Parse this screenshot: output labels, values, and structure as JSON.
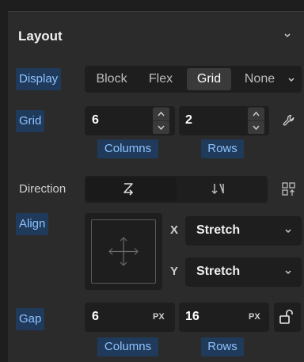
{
  "section": {
    "title": "Layout"
  },
  "display": {
    "label": "Display",
    "options": [
      "Block",
      "Flex",
      "Grid",
      "None"
    ],
    "selected": "Grid"
  },
  "grid": {
    "label": "Grid",
    "columns_value": "6",
    "rows_value": "2",
    "columns_label": "Columns",
    "rows_label": "Rows"
  },
  "direction": {
    "label": "Direction",
    "selected": "row"
  },
  "align": {
    "label": "Align",
    "x_label": "X",
    "x_value": "Stretch",
    "y_label": "Y",
    "y_value": "Stretch"
  },
  "gap": {
    "label": "Gap",
    "columns_value": "6",
    "columns_unit": "PX",
    "rows_value": "16",
    "rows_unit": "PX",
    "columns_label": "Columns",
    "rows_label": "Rows"
  },
  "colors": {
    "highlight_bg": "#1f3a5a",
    "highlight_text": "#8fc3ff",
    "panel_bg": "#2b2b2b",
    "field_bg": "#1e1e1e"
  }
}
